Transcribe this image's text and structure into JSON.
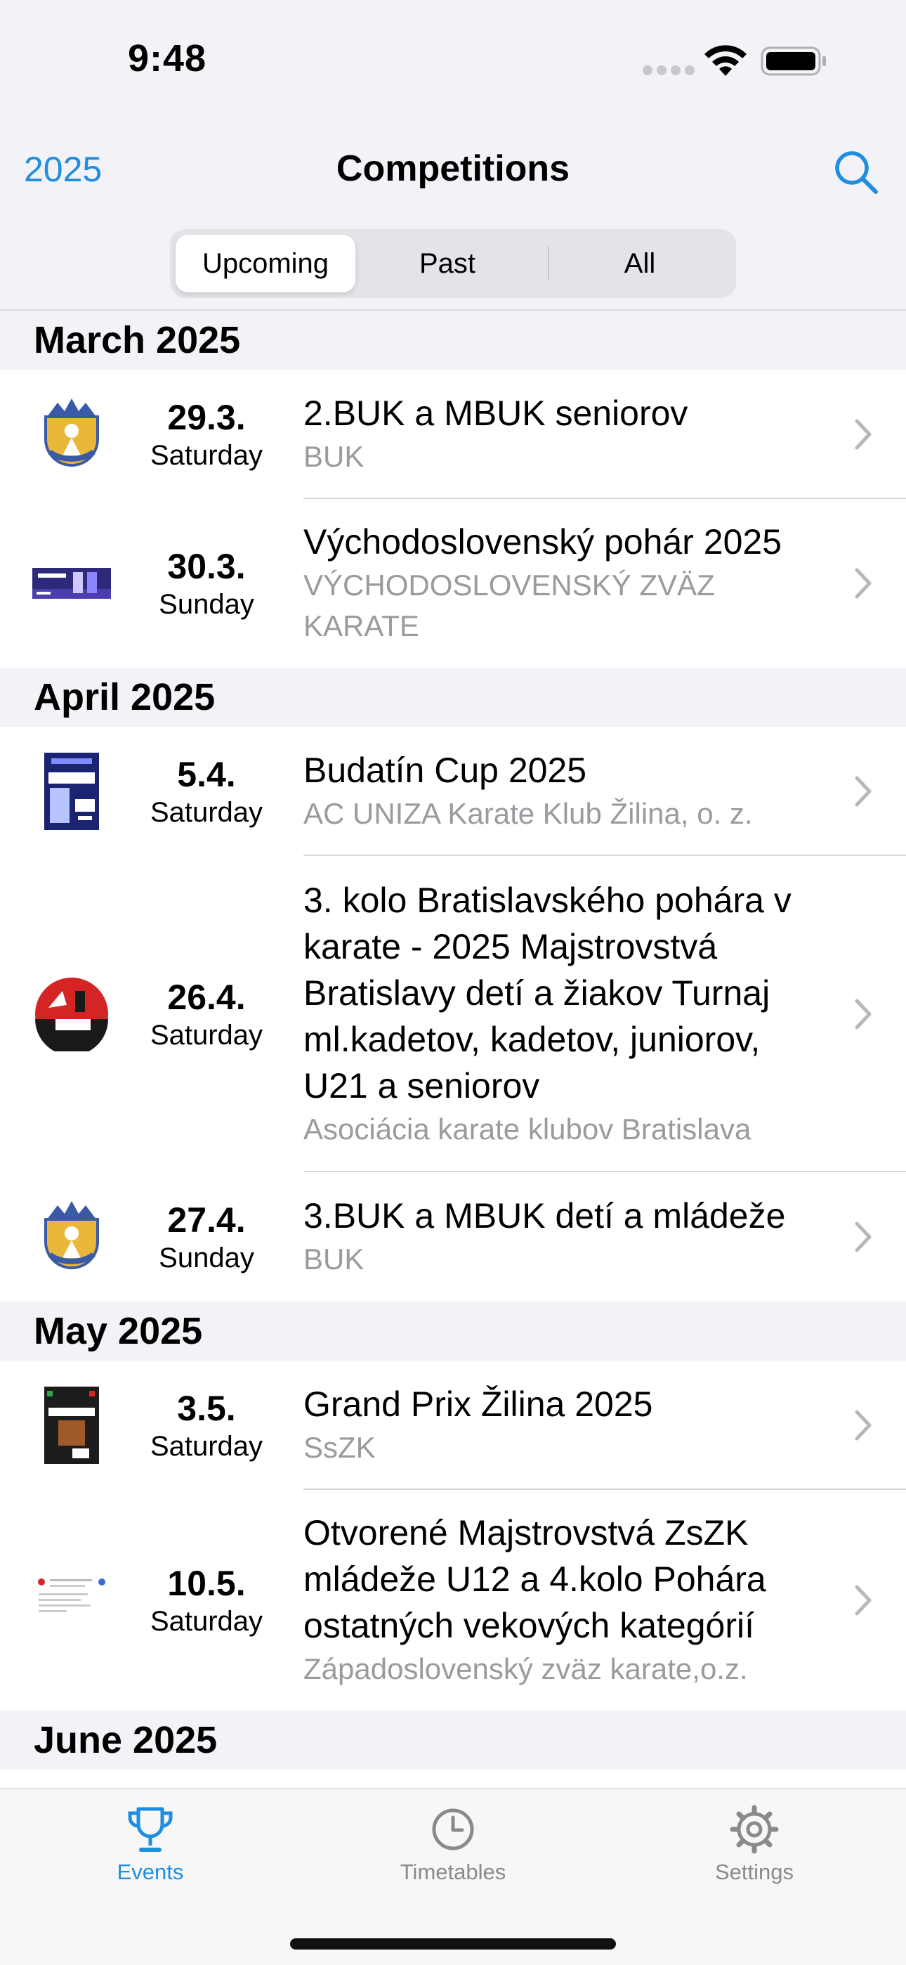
{
  "status": {
    "time": "9:48"
  },
  "nav": {
    "year": "2025",
    "title": "Competitions"
  },
  "segments": [
    {
      "label": "Upcoming",
      "selected": true
    },
    {
      "label": "Past",
      "selected": false
    },
    {
      "label": "All",
      "selected": false
    }
  ],
  "sections": [
    {
      "header": "March 2025",
      "items": [
        {
          "date": "29.3.",
          "day": "Saturday",
          "title": "2.BUK a MBUK seniorov",
          "subtitle": "BUK",
          "thumb": "buk-logo-icon"
        },
        {
          "date": "30.3.",
          "day": "Sunday",
          "title": "Východoslovenský pohár 2025",
          "subtitle": "VÝCHODOSLOVENSKÝ ZVÄZ KARATE",
          "thumb": "event-banner-image"
        }
      ]
    },
    {
      "header": "April 2025",
      "items": [
        {
          "date": "5.4.",
          "day": "Saturday",
          "title": "Budatín Cup 2025",
          "subtitle": "AC UNIZA Karate Klub Žilina, o. z.",
          "thumb": "karate-cup-poster-image"
        },
        {
          "date": "26.4.",
          "day": "Saturday",
          "title": "3. kolo Bratislavského pohára v karate - 2025 Majstrovstvá Bratislavy detí a žiakov Turnaj ml.kadetov, kadetov, juniorov, U21 a seniorov",
          "subtitle": "Asociácia karate klubov Bratislava",
          "thumb": "akkb-logo-icon"
        },
        {
          "date": "27.4.",
          "day": "Sunday",
          "title": "3.BUK a MBUK detí a mládeže",
          "subtitle": "BUK",
          "thumb": "buk-logo-icon"
        }
      ]
    },
    {
      "header": "May 2025",
      "items": [
        {
          "date": "3.5.",
          "day": "Saturday",
          "title": "Grand Prix Žilina 2025",
          "subtitle": "SsZK",
          "thumb": "grandprix-poster-image"
        },
        {
          "date": "10.5.",
          "day": "Saturday",
          "title": "Otvorené Majstrovstvá ZsZK mládeže U12 a 4.kolo Pohára ostatných vekových kategórií",
          "subtitle": "Západoslovenský zväz karate,o.z.",
          "thumb": "document-thumbnail-image"
        }
      ]
    },
    {
      "header": "June 2025",
      "items": []
    }
  ],
  "tabs": [
    {
      "label": "Events",
      "icon": "trophy-icon",
      "active": true
    },
    {
      "label": "Timetables",
      "icon": "clock-icon",
      "active": false
    },
    {
      "label": "Settings",
      "icon": "gear-icon",
      "active": false
    }
  ],
  "colors": {
    "accent": "#1f8ee0",
    "secondary_text": "#9a9a9f",
    "background": "#f2f2f7"
  }
}
